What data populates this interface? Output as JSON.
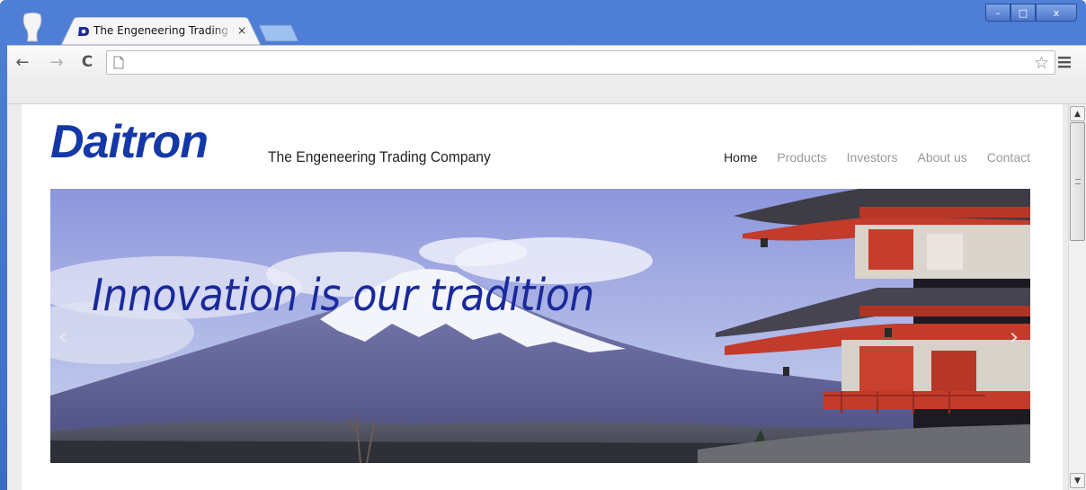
{
  "browser": {
    "tab_title": "The Engeneering Trading C",
    "tab_close": "×",
    "address_value": "",
    "address_placeholder": "",
    "win_min": "–",
    "win_max": "□",
    "win_close": "x",
    "back": "←",
    "forward": "→",
    "reload": "C",
    "star": "☆"
  },
  "site": {
    "logo": "Daitron",
    "tagline": "The Engeneering Trading Company",
    "nav": [
      {
        "label": "Home",
        "active": true
      },
      {
        "label": "Products",
        "active": false
      },
      {
        "label": "Investors",
        "active": false
      },
      {
        "label": "About us",
        "active": false
      },
      {
        "label": "Contact",
        "active": false
      }
    ],
    "hero_caption": "Innovation is our tradition",
    "carousel_prev": "‹",
    "carousel_next": "›"
  },
  "colors": {
    "brand": "#1538a8",
    "caption": "#1a2a9a",
    "frame": "#4a7bd4"
  }
}
